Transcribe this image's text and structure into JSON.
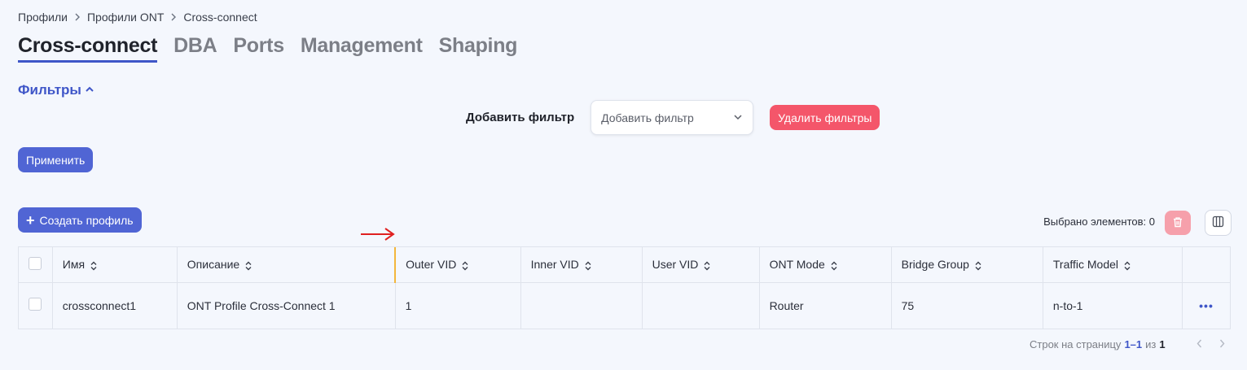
{
  "breadcrumb": [
    "Профили",
    "Профили ONT",
    "Cross-connect"
  ],
  "tabs": [
    {
      "label": "Cross-connect",
      "active": true
    },
    {
      "label": "DBA",
      "active": false
    },
    {
      "label": "Ports",
      "active": false
    },
    {
      "label": "Management",
      "active": false
    },
    {
      "label": "Shaping",
      "active": false
    }
  ],
  "filters": {
    "toggle_label": "Фильтры",
    "add_filter_label": "Добавить фильтр",
    "add_filter_placeholder": "Добавить фильтр",
    "delete_filters_label": "Удалить фильтры",
    "apply_label": "Применить"
  },
  "toolbar": {
    "create_label": "Создать профиль",
    "selected_text": "Выбрано элементов: 0"
  },
  "table": {
    "columns": [
      "Имя",
      "Описание",
      "Outer VID",
      "Inner VID",
      "User VID",
      "ONT Mode",
      "Bridge Group",
      "Traffic Model"
    ],
    "rows": [
      [
        "crossconnect1",
        "ONT Profile Cross-Connect 1",
        "1",
        "",
        "",
        "Router",
        "75",
        "n-to-1"
      ]
    ],
    "row_menu": "•••"
  },
  "pagination": {
    "rows_per_page_label": "Строк на страницу",
    "range": "1–1",
    "of_label": "из",
    "total": "1"
  },
  "colors": {
    "accent": "#3f56c8",
    "primary_button": "#5065d4",
    "danger": "#f4566a",
    "highlight_border": "#f3b63c",
    "annotation_arrow": "#e02020"
  },
  "icons": {
    "breadcrumb_separator": "chevron-right-icon",
    "filters_toggle": "chevron-up-icon",
    "select_arrow": "chevron-down-icon",
    "create": "plus-icon",
    "delete": "trash-icon",
    "columns": "columns-icon",
    "sort": "sort-icon",
    "annotation": "red-arrow-icon"
  }
}
